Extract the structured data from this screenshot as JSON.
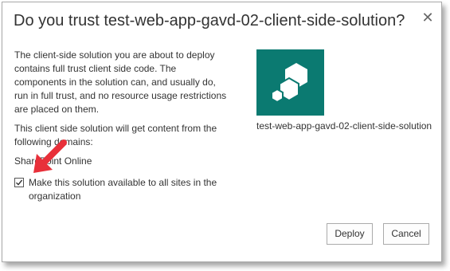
{
  "dialog": {
    "title": "Do you trust test-web-app-gavd-02-client-side-solution?",
    "close_glyph": "✕",
    "paragraph1": "The client-side solution you are about to deploy contains full trust client side code. The components in the solution can, and usually do, run in full trust, and no resource usage restrictions are placed on them.",
    "paragraph2": "This client side solution will get content from the following domains:",
    "domain": "SharePoint Online",
    "checkbox": {
      "label": "Make this solution available to all sites in the organization",
      "checked": true
    },
    "solution_name": "test-web-app-gavd-02-client-side-solution",
    "buttons": {
      "deploy": "Deploy",
      "cancel": "Cancel"
    }
  },
  "colors": {
    "logo_tile": "#0b7a71",
    "annotation_arrow": "#e8303a"
  },
  "icons": {
    "close": "close-icon",
    "logo": "sharepoint-solution-logo-icon",
    "annotation": "red-arrow-annotation-icon"
  }
}
